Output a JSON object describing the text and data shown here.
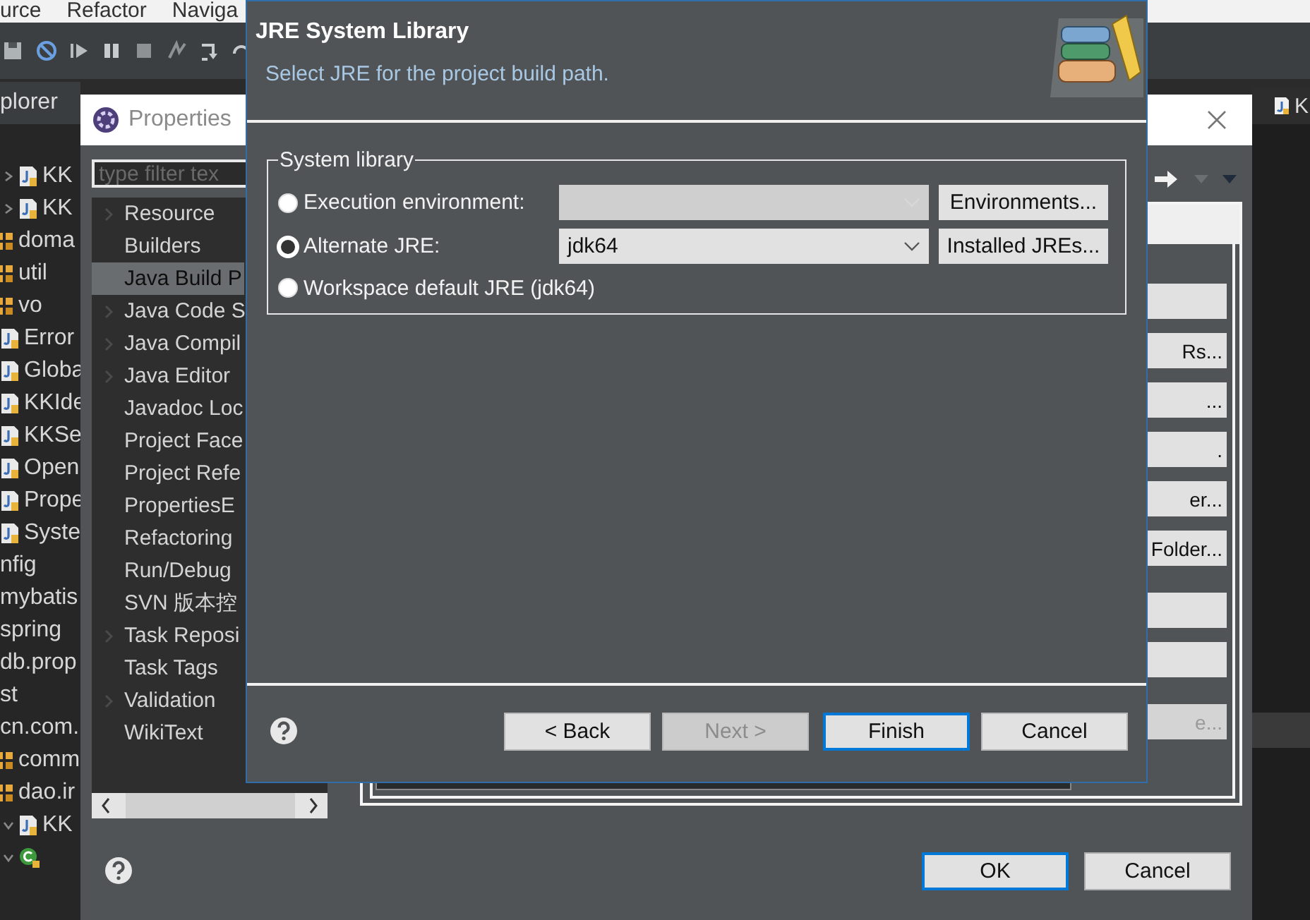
{
  "ide": {
    "menu": [
      {
        "label": "urce"
      },
      {
        "label": "Refactor"
      },
      {
        "label": "Naviga"
      }
    ],
    "explorer_tab": "plorer",
    "explorer_tree": [
      {
        "text": "KK",
        "kind": "java",
        "expanded": false
      },
      {
        "text": "KK",
        "kind": "java",
        "expanded": false
      },
      {
        "text": "doma",
        "kind": "package"
      },
      {
        "text": "util",
        "kind": "package"
      },
      {
        "text": "vo",
        "kind": "package"
      },
      {
        "text": "Error",
        "kind": "java"
      },
      {
        "text": "Globa",
        "kind": "java"
      },
      {
        "text": "KKIde",
        "kind": "java"
      },
      {
        "text": "KKSe",
        "kind": "java"
      },
      {
        "text": "Open",
        "kind": "java"
      },
      {
        "text": "Prope",
        "kind": "java"
      },
      {
        "text": "Syste",
        "kind": "java"
      },
      {
        "text": "nfig",
        "kind": "plain"
      },
      {
        "text": "mybatis",
        "kind": "plain"
      },
      {
        "text": "spring",
        "kind": "plain"
      },
      {
        "text": "db.prop",
        "kind": "plain"
      },
      {
        "text": "st",
        "kind": "plain"
      },
      {
        "text": "cn.com.",
        "kind": "plain"
      },
      {
        "text": "comm",
        "kind": "package"
      },
      {
        "text": "dao.ir",
        "kind": "package"
      },
      {
        "text": "KK",
        "kind": "java",
        "expanded": true
      },
      {
        "kind": "class",
        "expanded": true
      }
    ],
    "editor_tab": "K"
  },
  "properties": {
    "title": "Properties",
    "filter": {
      "placeholder": "type filter tex"
    },
    "pages": [
      {
        "label": "Resource",
        "expandable": true,
        "selected": false
      },
      {
        "label": "Builders",
        "expandable": false,
        "selected": false
      },
      {
        "label": "Java Build P",
        "expandable": false,
        "selected": true
      },
      {
        "label": "Java Code S",
        "expandable": true,
        "selected": false
      },
      {
        "label": "Java Compil",
        "expandable": true,
        "selected": false
      },
      {
        "label": "Java Editor",
        "expandable": true,
        "selected": false
      },
      {
        "label": "Javadoc Loc",
        "expandable": false,
        "selected": false
      },
      {
        "label": "Project Face",
        "expandable": false,
        "selected": false
      },
      {
        "label": "Project Refe",
        "expandable": false,
        "selected": false
      },
      {
        "label": "PropertiesE",
        "expandable": false,
        "selected": false
      },
      {
        "label": "Refactoring",
        "expandable": false,
        "selected": false
      },
      {
        "label": "Run/Debug",
        "expandable": false,
        "selected": false
      },
      {
        "label": "SVN 版本控",
        "expandable": false,
        "selected": false
      },
      {
        "label": "Task Reposi",
        "expandable": true,
        "selected": false
      },
      {
        "label": "Task Tags",
        "expandable": false,
        "selected": false
      },
      {
        "label": "Validation",
        "expandable": true,
        "selected": false
      },
      {
        "label": "WikiText",
        "expandable": false,
        "selected": false
      }
    ],
    "side_buttons": [
      {
        "disabled": false
      },
      {
        "label": "Rs...",
        "disabled": false
      },
      {
        "label": "...",
        "disabled": false
      },
      {
        "label": ".",
        "disabled": false
      },
      {
        "label": "er...",
        "disabled": false
      },
      {
        "label": "Folder...",
        "disabled": false
      },
      {
        "disabled": false
      },
      {
        "disabled": false
      },
      {
        "label": "e...",
        "disabled": true
      }
    ],
    "buttons": [
      {
        "label": "OK",
        "default": true
      },
      {
        "label": "Cancel",
        "default": false
      }
    ]
  },
  "jre_dialog": {
    "title": "JRE System Library",
    "subtitle": "Select JRE for the project build path.",
    "group": "System library",
    "options": [
      {
        "label": "Execution environment:",
        "selected": false,
        "kind": "combo",
        "disabled": true,
        "button": "Environments..."
      },
      {
        "label": "Alternate JRE:",
        "selected": true,
        "kind": "combo",
        "disabled": false,
        "value": "jdk64",
        "button": "Installed JREs..."
      },
      {
        "label": "Workspace default JRE (jdk64)",
        "selected": false,
        "kind": "plain"
      }
    ],
    "buttons": [
      {
        "label": "< Back",
        "disabled": false,
        "default": false
      },
      {
        "label": "Next >",
        "disabled": true,
        "default": false
      },
      {
        "label": "Finish",
        "disabled": false,
        "default": true
      },
      {
        "label": "Cancel",
        "disabled": false,
        "default": false
      }
    ]
  }
}
